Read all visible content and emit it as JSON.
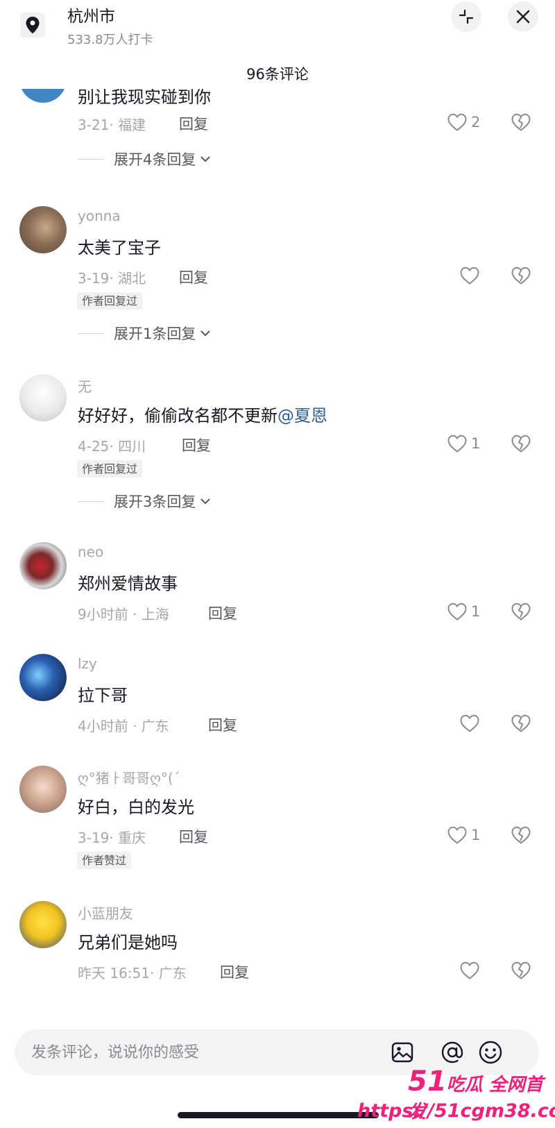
{
  "header": {
    "location_name": "杭州市",
    "checkins": "533.8万人打卡",
    "comment_count_title": "96条评论"
  },
  "comments": [
    {
      "username": "",
      "text": "别让我现实碰到你",
      "meta": "3-21· 福建",
      "reply_label": "回复",
      "likes": "2",
      "tag": "",
      "expand_label": "展开4条回复"
    },
    {
      "username": "yonna",
      "text": "太美了宝子",
      "meta": "3-19· 湖北",
      "reply_label": "回复",
      "likes": "",
      "tag": "作者回复过",
      "expand_label": "展开1条回复"
    },
    {
      "username": "无",
      "text": "好好好，偷偷改名都不更新",
      "mention": "@夏恩",
      "meta": "4-25· 四川",
      "reply_label": "回复",
      "likes": "1",
      "tag": "作者回复过",
      "expand_label": "展开3条回复"
    },
    {
      "username": "neo",
      "text": "郑州爱情故事",
      "meta": "9小时前 · 上海",
      "reply_label": "回复",
      "likes": "1",
      "tag": "",
      "expand_label": ""
    },
    {
      "username": "lzy",
      "text": "拉下哥",
      "meta": "4小时前 · 广东",
      "reply_label": "回复",
      "likes": "",
      "tag": "",
      "expand_label": ""
    },
    {
      "username": "ღ°猪ㅏ哥哥ღ°(´",
      "text": "好白，白的发光",
      "meta": "3-19· 重庆",
      "reply_label": "回复",
      "likes": "1",
      "tag": "作者赞过",
      "expand_label": ""
    },
    {
      "username": "小蓝朋友",
      "text": "兄弟们是她吗",
      "meta": "昨天 16:51· 广东",
      "reply_label": "回复",
      "likes": "",
      "tag": "",
      "expand_label": ""
    }
  ],
  "input": {
    "placeholder": "发条评论，说说你的感受"
  },
  "watermark": {
    "brand_num": "51",
    "brand_text": "吃瓜 全网首发",
    "url": "https://51cgm38.com"
  },
  "colors": {
    "text_primary": "#161823",
    "text_secondary": "#a6a7ab",
    "mention": "#2f5e9b",
    "watermark": "#f0217a"
  },
  "icons": [
    "location-pin-icon",
    "collapse-icon",
    "close-icon",
    "heart-icon",
    "broken-heart-icon",
    "chevron-down-icon",
    "image-icon",
    "at-icon",
    "emoji-icon"
  ]
}
